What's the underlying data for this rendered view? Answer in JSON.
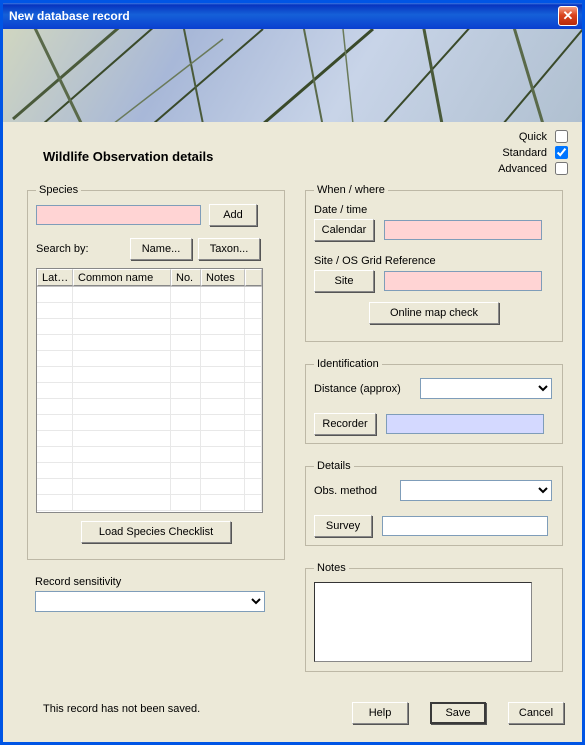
{
  "window": {
    "title": "New database record"
  },
  "modes": {
    "quick": {
      "label": "Quick",
      "checked": false
    },
    "standard": {
      "label": "Standard",
      "checked": true
    },
    "advanced": {
      "label": "Advanced",
      "checked": false
    }
  },
  "heading": "Wildlife Observation details",
  "species": {
    "legend": "Species",
    "input_value": "",
    "add_btn": "Add",
    "search_by_label": "Search by:",
    "name_btn": "Name...",
    "taxon_btn": "Taxon...",
    "columns": {
      "latin": "Lat…",
      "common": "Common name",
      "no": "No.",
      "notes": "Notes"
    },
    "rows": [],
    "load_btn": "Load Species Checklist"
  },
  "sensitivity": {
    "label": "Record sensitivity",
    "value": ""
  },
  "when_where": {
    "legend": "When / where",
    "date_label": "Date / time",
    "calendar_btn": "Calendar",
    "date_value": "",
    "site_label": "Site / OS Grid Reference",
    "site_btn": "Site",
    "site_value": "",
    "map_btn": "Online map check"
  },
  "identification": {
    "legend": "Identification",
    "distance_label": "Distance (approx)",
    "distance_value": "",
    "recorder_btn": "Recorder",
    "recorder_value": ""
  },
  "details": {
    "legend": "Details",
    "obs_label": "Obs. method",
    "obs_value": "",
    "survey_btn": "Survey",
    "survey_value": ""
  },
  "notes": {
    "legend": "Notes",
    "value": ""
  },
  "status": "This record has not been saved.",
  "buttons": {
    "help": "Help",
    "save": "Save",
    "cancel": "Cancel"
  }
}
